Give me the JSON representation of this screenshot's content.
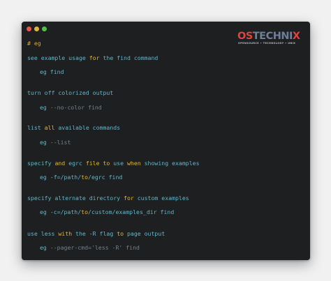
{
  "window": {
    "traffic_lights": [
      {
        "name": "close",
        "color": "#e2584d"
      },
      {
        "name": "minimize",
        "color": "#e3b43c"
      },
      {
        "name": "maximize",
        "color": "#55bd45"
      }
    ]
  },
  "logo": {
    "os": "OS",
    "rest": "TECHNI",
    "x": "X",
    "tagline": "OPENSOURCE • TECHNOLOGY • UNIX"
  },
  "colors": {
    "background": "#f1f1f1",
    "terminal_bg": "#1e1f21",
    "text_cyan": "#5fb7cb",
    "keyword_yellow": "#e8b42e",
    "dim_gray": "#74808c",
    "logo_red": "#e0443a",
    "logo_slate": "#6d7f9a"
  },
  "terminal": {
    "heading": "# eg",
    "blocks": [
      {
        "desc": [
          {
            "t": "see example usage ",
            "s": "plain"
          },
          {
            "t": "for",
            "s": "kw"
          },
          {
            "t": " the find command",
            "s": "plain"
          }
        ],
        "cmd": [
          {
            "t": "eg find",
            "s": "plain"
          }
        ]
      },
      {
        "desc": [
          {
            "t": "turn off colorized output",
            "s": "plain"
          }
        ],
        "cmd": [
          {
            "t": "eg ",
            "s": "plain"
          },
          {
            "t": "--no-color find",
            "s": "dim"
          }
        ]
      },
      {
        "desc": [
          {
            "t": "list ",
            "s": "plain"
          },
          {
            "t": "all",
            "s": "kw"
          },
          {
            "t": " available commands",
            "s": "plain"
          }
        ],
        "cmd": [
          {
            "t": "eg ",
            "s": "plain"
          },
          {
            "t": "--list",
            "s": "dim"
          }
        ]
      },
      {
        "desc": [
          {
            "t": "specify ",
            "s": "plain"
          },
          {
            "t": "and",
            "s": "kw"
          },
          {
            "t": " egrc ",
            "s": "plain"
          },
          {
            "t": "file",
            "s": "kw"
          },
          {
            "t": " ",
            "s": "plain"
          },
          {
            "t": "to",
            "s": "kw"
          },
          {
            "t": " use ",
            "s": "plain"
          },
          {
            "t": "when",
            "s": "kw"
          },
          {
            "t": " showing examples",
            "s": "plain"
          }
        ],
        "cmd": [
          {
            "t": "eg -f=/path/",
            "s": "plain"
          },
          {
            "t": "to",
            "s": "kw"
          },
          {
            "t": "/egrc find",
            "s": "plain"
          }
        ]
      },
      {
        "desc": [
          {
            "t": "specify alternate directory ",
            "s": "plain"
          },
          {
            "t": "for",
            "s": "kw"
          },
          {
            "t": " custom examples",
            "s": "plain"
          }
        ],
        "cmd": [
          {
            "t": "eg -c=/path/",
            "s": "plain"
          },
          {
            "t": "to",
            "s": "kw"
          },
          {
            "t": "/custom/examples_dir find",
            "s": "plain"
          }
        ]
      },
      {
        "desc": [
          {
            "t": "use less ",
            "s": "plain"
          },
          {
            "t": "with",
            "s": "kw"
          },
          {
            "t": " the -R flag ",
            "s": "plain"
          },
          {
            "t": "to",
            "s": "kw"
          },
          {
            "t": " page output",
            "s": "plain"
          }
        ],
        "cmd": [
          {
            "t": "eg ",
            "s": "plain"
          },
          {
            "t": "--pager-cmd='less -R' find",
            "s": "dim"
          }
        ]
      }
    ]
  }
}
